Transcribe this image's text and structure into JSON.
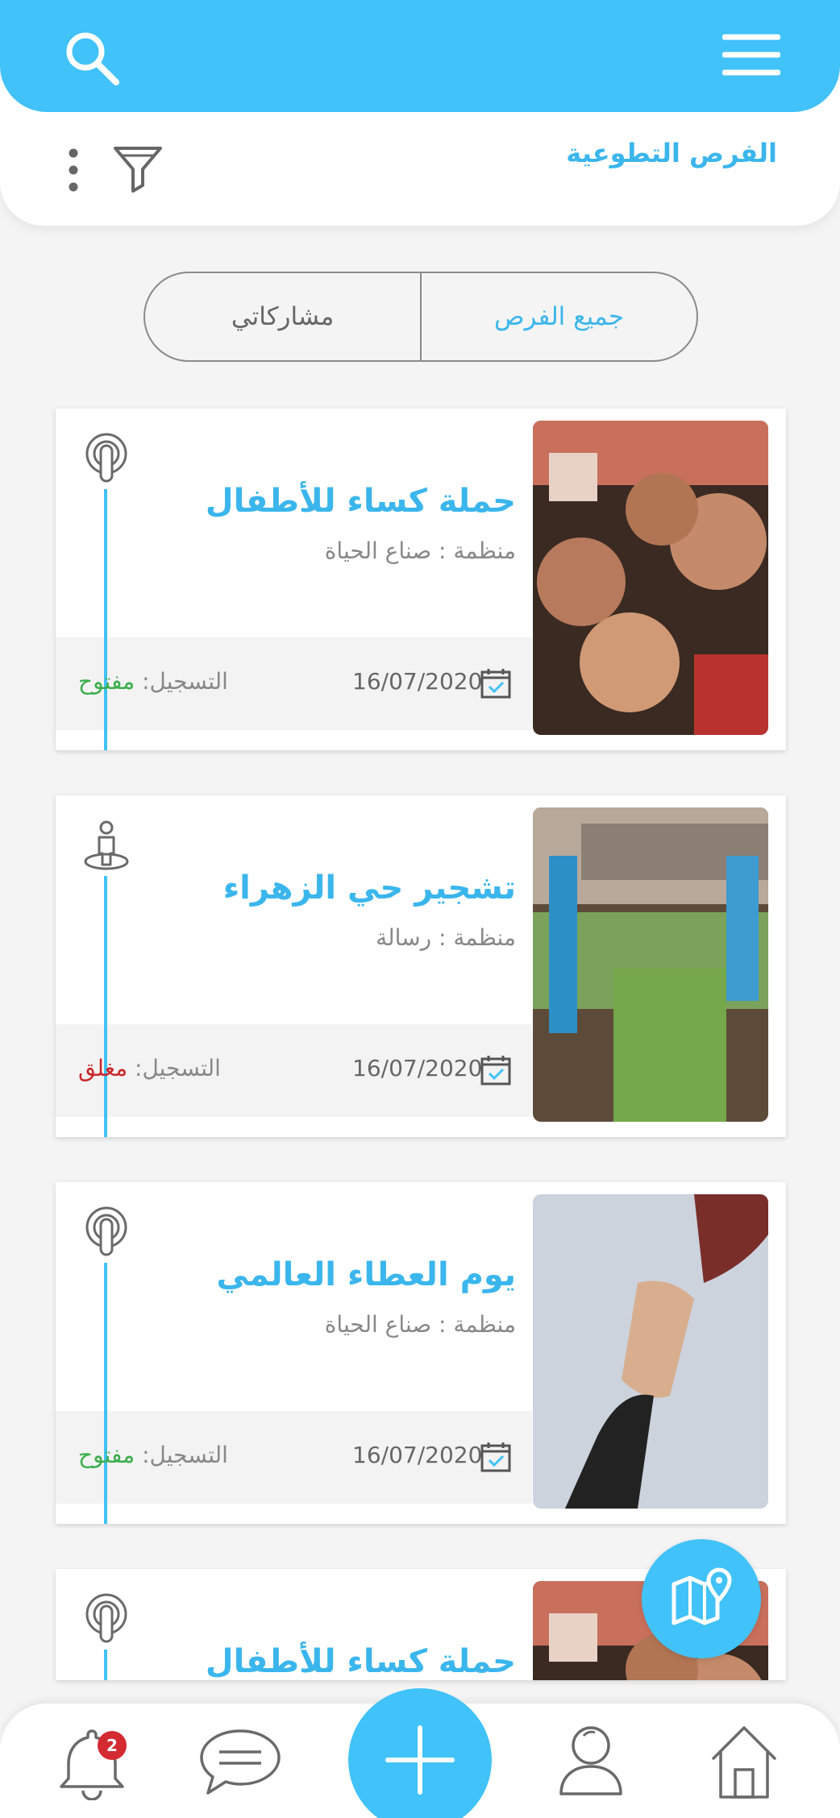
{
  "header": {
    "page_title": "الفرص التطوعية",
    "menu_icon": "hamburger-menu-icon",
    "search_icon": "search-icon",
    "filter_icon": "filter-funnel-icon",
    "more_icon": "more-vertical-icon"
  },
  "tabs": {
    "all": "جميع الفرص",
    "mine": "مشاركاتي"
  },
  "cards": [
    {
      "title": "حملة كساء للأطفال",
      "org": "منظمة : صناع الحياة",
      "date": "16/07/2020",
      "reg_label": "التسجيل:",
      "reg_status": "مفتوح",
      "status_color": "#3aae4a",
      "type_icon": "podcast-icon",
      "photo": "children-photo"
    },
    {
      "title": "تشجير حي الزهراء",
      "org": "منظمة : رسالة",
      "date": "16/07/2020",
      "reg_label": "التسجيل:",
      "reg_status": "مغلق",
      "status_color": "#c8282a",
      "type_icon": "person-on-location-icon",
      "photo": "planting-photo"
    },
    {
      "title": "يوم العطاء العالمي",
      "org": "منظمة : صناع الحياة",
      "date": "16/07/2020",
      "reg_label": "التسجيل:",
      "reg_status": "مفتوح",
      "status_color": "#3aae4a",
      "type_icon": "podcast-icon",
      "photo": "hands-photo"
    },
    {
      "title": "حملة كساء للأطفال",
      "type_icon": "podcast-icon",
      "photo": "children-photo"
    }
  ],
  "bottom_nav": {
    "notifications_count": "2",
    "items": [
      "bell-icon",
      "chat-icon",
      "add-icon",
      "user-icon",
      "home-icon"
    ]
  },
  "colors": {
    "primary": "#41c2f8",
    "title_blue": "#3bb6ec",
    "open": "#3aae4a",
    "closed": "#c8282a",
    "badge": "#d42a32"
  }
}
